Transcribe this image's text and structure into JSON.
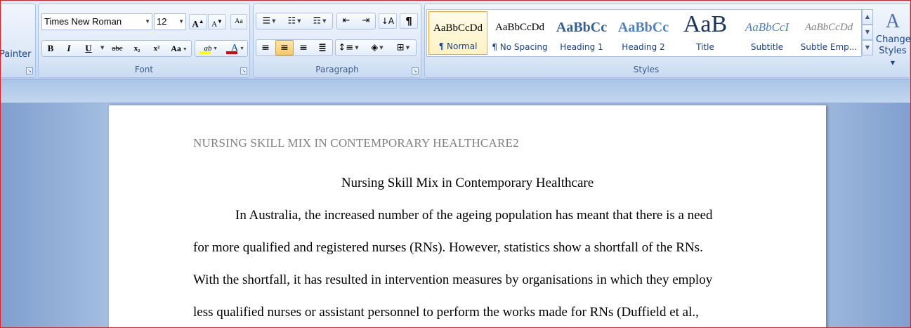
{
  "ribbon": {
    "clipboard": {
      "painter_label": "Painter"
    },
    "font": {
      "label": "Font",
      "font_name": "Times New Roman",
      "font_size": "12",
      "grow_label": "A",
      "shrink_label": "A",
      "clear_label": "Aa",
      "bold": "B",
      "italic": "I",
      "underline": "U",
      "strike": "abc",
      "subscript": "x₂",
      "superscript": "x²",
      "change_case": "Aa",
      "highlight": "ab",
      "font_color": "A"
    },
    "paragraph": {
      "label": "Paragraph",
      "pilcrow": "¶"
    },
    "styles": {
      "label": "Styles",
      "items": [
        {
          "sample": "AaBbCcDd",
          "name": "¶ Normal"
        },
        {
          "sample": "AaBbCcDd",
          "name": "¶ No Spacing"
        },
        {
          "sample": "AaBbCc",
          "name": "Heading 1"
        },
        {
          "sample": "AaBbCc",
          "name": "Heading 2"
        },
        {
          "sample": "AaB",
          "name": "Title"
        },
        {
          "sample": "AaBbCcI",
          "name": "Subtitle"
        },
        {
          "sample": "AaBbCcDd",
          "name": "Subtle Emp..."
        }
      ],
      "change_styles_line1": "Change",
      "change_styles_line2": "Styles"
    }
  },
  "document": {
    "header": "NURSING SKILL MIX IN CONTEMPORARY  HEALTHCARE2",
    "title": "Nursing Skill Mix in Contemporary Healthcare",
    "lines": [
      "In Australia, the increased number of the ageing population has meant that there is a need",
      "for more qualified and registered nurses (RNs). However, statistics show a shortfall of the RNs.",
      "With the shortfall, it has resulted in intervention measures by organisations in which they employ",
      "less qualified nurses or assistant personnel to perform the works made  for RNs  (Duffield et al.,"
    ]
  },
  "colors": {
    "ribbon_text": "#15428b",
    "active_style_border": "#e8a33f",
    "frame_border": "#d8222a",
    "font_color_bar": "#e00000",
    "highlight_bar": "#ffff00"
  }
}
